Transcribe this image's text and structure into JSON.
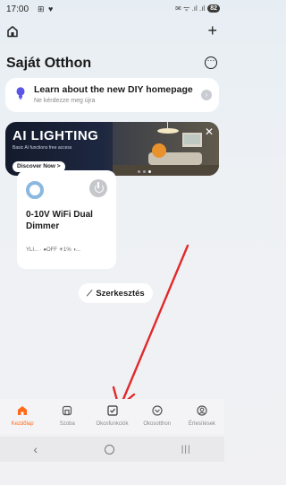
{
  "status_bar": {
    "time": "17:00",
    "left_icons": "⊞ ♥",
    "right_icons": "✉ ᯤ .ıl .ıl",
    "battery": "82"
  },
  "header": {
    "title": "Saját Otthon"
  },
  "diy_banner": {
    "title": "Learn about the new DIY homepage",
    "subtitle": "Ne kérdezze meg újra",
    "arrow": "›"
  },
  "promo": {
    "title": "AI LIGHTING",
    "subtitle": "Basic AI functions free access",
    "button_label": "Discover Now >",
    "close": "✕"
  },
  "device": {
    "name": "0-10V WiFi Dual Dimmer",
    "status": "YLI... · ●OFF ☀1% ◑..."
  },
  "edit": {
    "icon": "⟋",
    "label": "Szerkesztés"
  },
  "bottom_nav": {
    "items": [
      {
        "label": "Kezdőlap",
        "icon": "home-icon"
      },
      {
        "label": "Szoba",
        "icon": "room-icon"
      },
      {
        "label": "Okosfunkciók",
        "icon": "smart-icon"
      },
      {
        "label": "Okosotthon",
        "icon": "smart-home-icon"
      },
      {
        "label": "Értesítések",
        "icon": "profile-icon"
      }
    ]
  },
  "system_nav": {
    "back": "‹",
    "recents": "|||"
  },
  "colors": {
    "accent": "#ff6a1a",
    "arrow": "#e2292b",
    "promo_bg": "#141a2c"
  }
}
